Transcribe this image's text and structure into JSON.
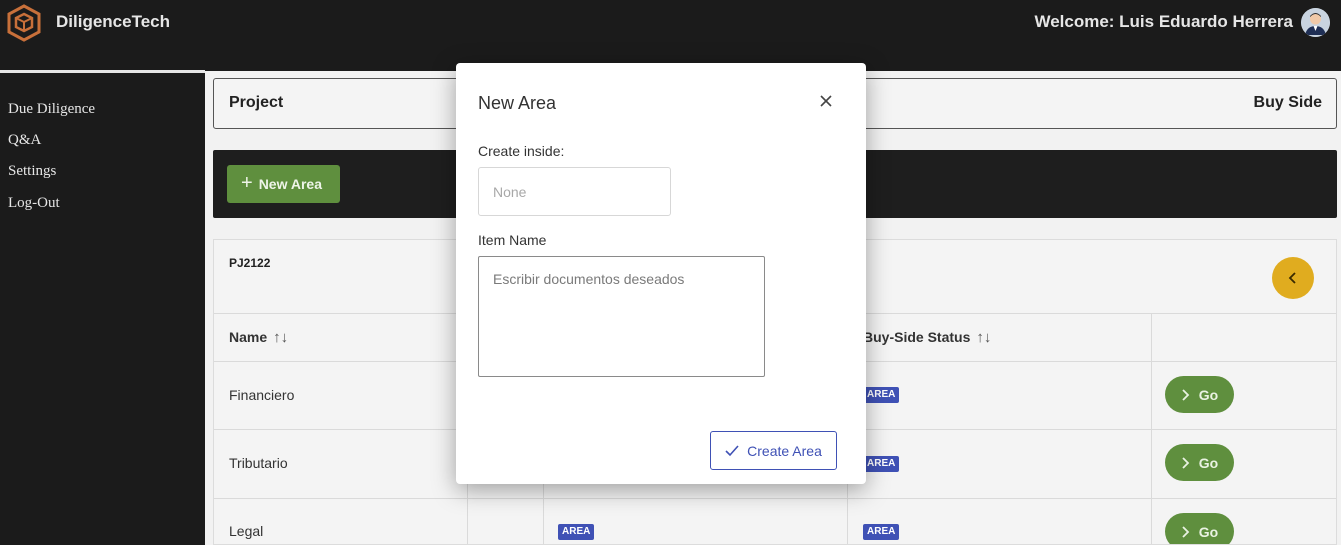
{
  "header": {
    "brand": "DiligenceTech",
    "welcome": "Welcome: Luis Eduardo Herrera",
    "logo_color": "#c8703a"
  },
  "sidebar": {
    "items": [
      {
        "label": "Due Diligence"
      },
      {
        "label": "Q&A"
      },
      {
        "label": "Settings"
      },
      {
        "label": "Log-Out"
      }
    ]
  },
  "project": {
    "title": "Project",
    "side": "Buy Side"
  },
  "toolbar": {
    "new_area_label": "New Area",
    "accent": "#5f8f3e"
  },
  "table": {
    "project_code": "PJ2122",
    "columns": {
      "name": "Name",
      "buy_side_status": "Buy-Side Status"
    },
    "rows": [
      {
        "name": "Financiero",
        "buy_status_badge": "AREA",
        "action": "Go"
      },
      {
        "name": "Tributario",
        "buy_status_badge": "AREA",
        "action": "Go"
      },
      {
        "name": "Legal",
        "status_badge": "AREA",
        "buy_status_badge": "AREA",
        "action": "Go"
      }
    ]
  },
  "modal": {
    "title": "New Area",
    "create_inside_label": "Create inside:",
    "create_inside_placeholder": "None",
    "item_name_label": "Item Name",
    "item_name_placeholder": "Escribir documentos deseados",
    "submit_label": "Create Area",
    "badge_color": "#3f51b5"
  }
}
